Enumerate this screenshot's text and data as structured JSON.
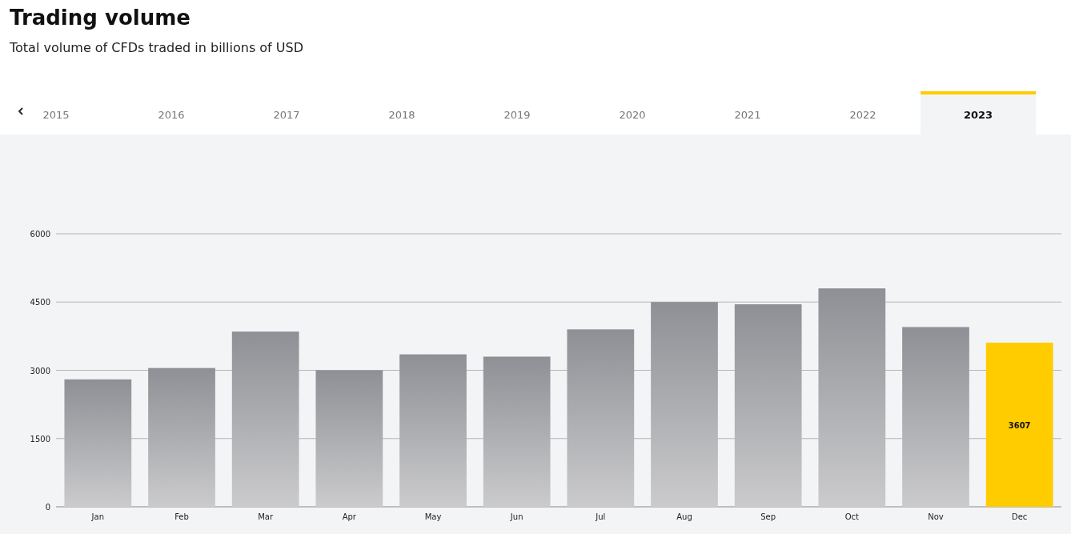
{
  "header": {
    "title": "Trading volume",
    "subtitle": "Total volume of CFDs traded in billions of USD"
  },
  "tabs": [
    {
      "label": "2015",
      "selected": false
    },
    {
      "label": "2016",
      "selected": false
    },
    {
      "label": "2017",
      "selected": false
    },
    {
      "label": "2018",
      "selected": false
    },
    {
      "label": "2019",
      "selected": false
    },
    {
      "label": "2020",
      "selected": false
    },
    {
      "label": "2021",
      "selected": false
    },
    {
      "label": "2022",
      "selected": false
    },
    {
      "label": "2023",
      "selected": true
    }
  ],
  "chart": {
    "chart_data": {
      "type": "bar",
      "categories": [
        "Jan",
        "Feb",
        "Mar",
        "Apr",
        "May",
        "Jun",
        "Jul",
        "Aug",
        "Sep",
        "Oct",
        "Nov",
        "Dec"
      ],
      "series": [
        {
          "color": "#8e9095",
          "values": [
            2800,
            3050,
            3850,
            3000,
            3350,
            3300,
            3900,
            4500,
            4450,
            4800,
            3950,
            null
          ]
        },
        {
          "color": "#ffcc00",
          "values": [
            null,
            null,
            null,
            null,
            null,
            null,
            null,
            null,
            null,
            null,
            null,
            3607
          ]
        }
      ],
      "stacked": true,
      "grid": true,
      "ylim": [
        0,
        6000
      ],
      "yticks": [
        0,
        1500,
        3000,
        4500,
        6000
      ],
      "annotations": [
        "3607"
      ]
    }
  }
}
